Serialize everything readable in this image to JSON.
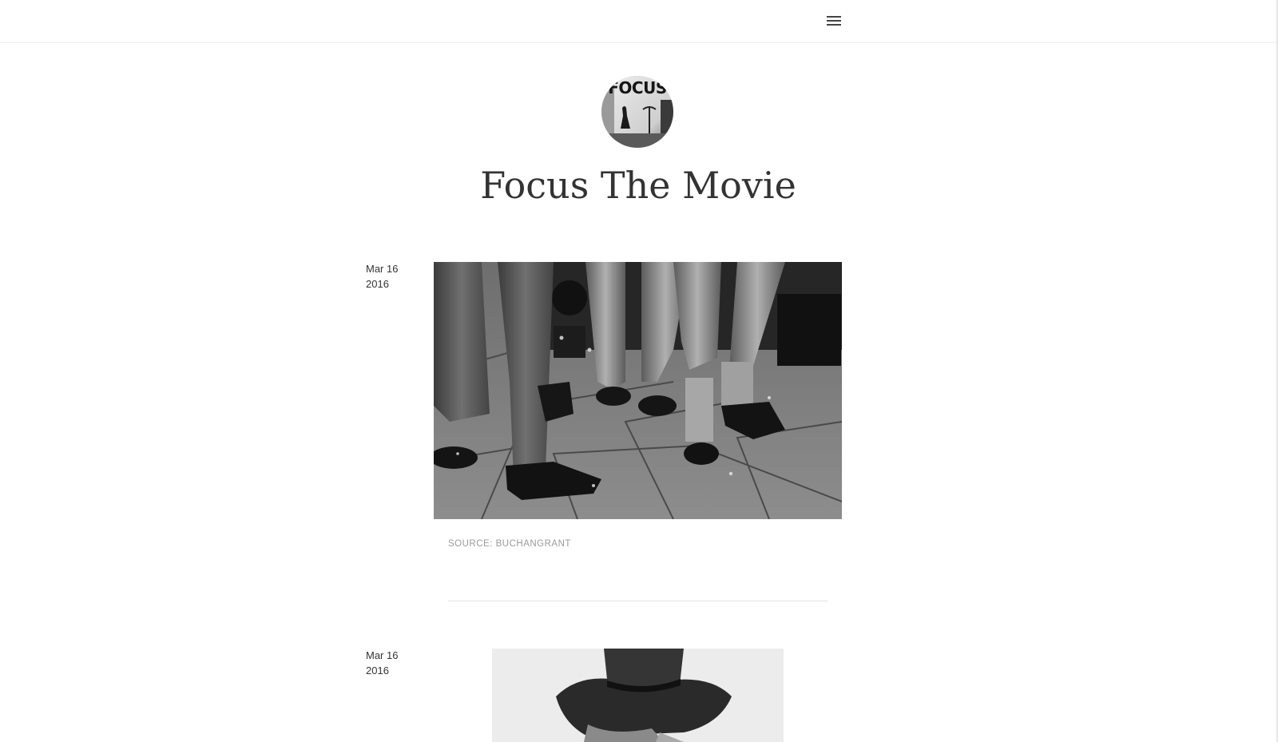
{
  "header": {
    "menu_icon": "hamburger-menu-icon"
  },
  "blog": {
    "avatar_text": "FOCUS",
    "title": "Focus The Movie"
  },
  "posts": [
    {
      "date_line1": "Mar 16",
      "date_line2": "2016",
      "source_label": "SOURCE:",
      "source_name": "BUCHANGRANT"
    },
    {
      "date_line1": "Mar 16",
      "date_line2": "2016"
    }
  ]
}
